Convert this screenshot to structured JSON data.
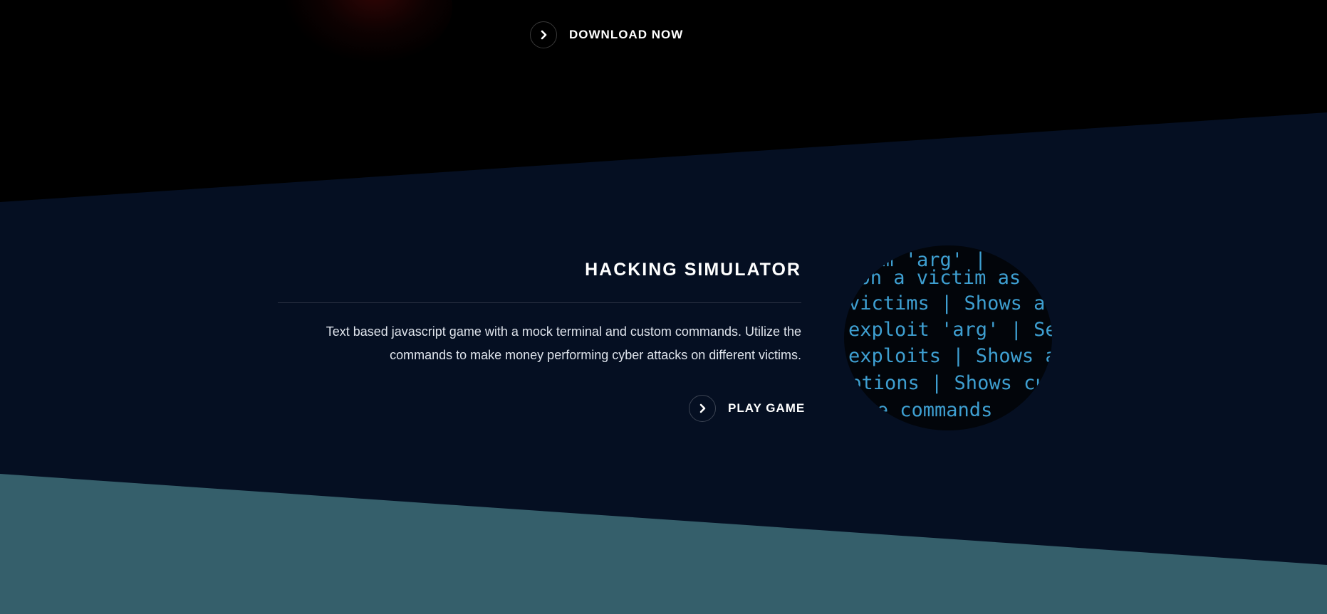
{
  "top_section": {
    "download_label": "DOWNLOAD NOW"
  },
  "project": {
    "title": "HACKING SIMULATOR",
    "description": "Text based javascript game with a mock terminal and custom commands. Utilize the commands to make money performing cyber attacks on different victims.",
    "play_label": "PLAY GAME",
    "terminal_lines": [
      "victim 'arg' |",
      "g on a victim as",
      "victims | Shows al",
      "exploit 'arg' | Set",
      "exploits | Shows al",
      "options | Shows cu",
      "sive commands"
    ]
  },
  "icons": {
    "arrow": "chevron-right-icon"
  },
  "colors": {
    "top_band": "#000000",
    "middle_band": "#050f22",
    "bottom_band": "#355f6b",
    "terminal_text": "#3e9fd1"
  }
}
